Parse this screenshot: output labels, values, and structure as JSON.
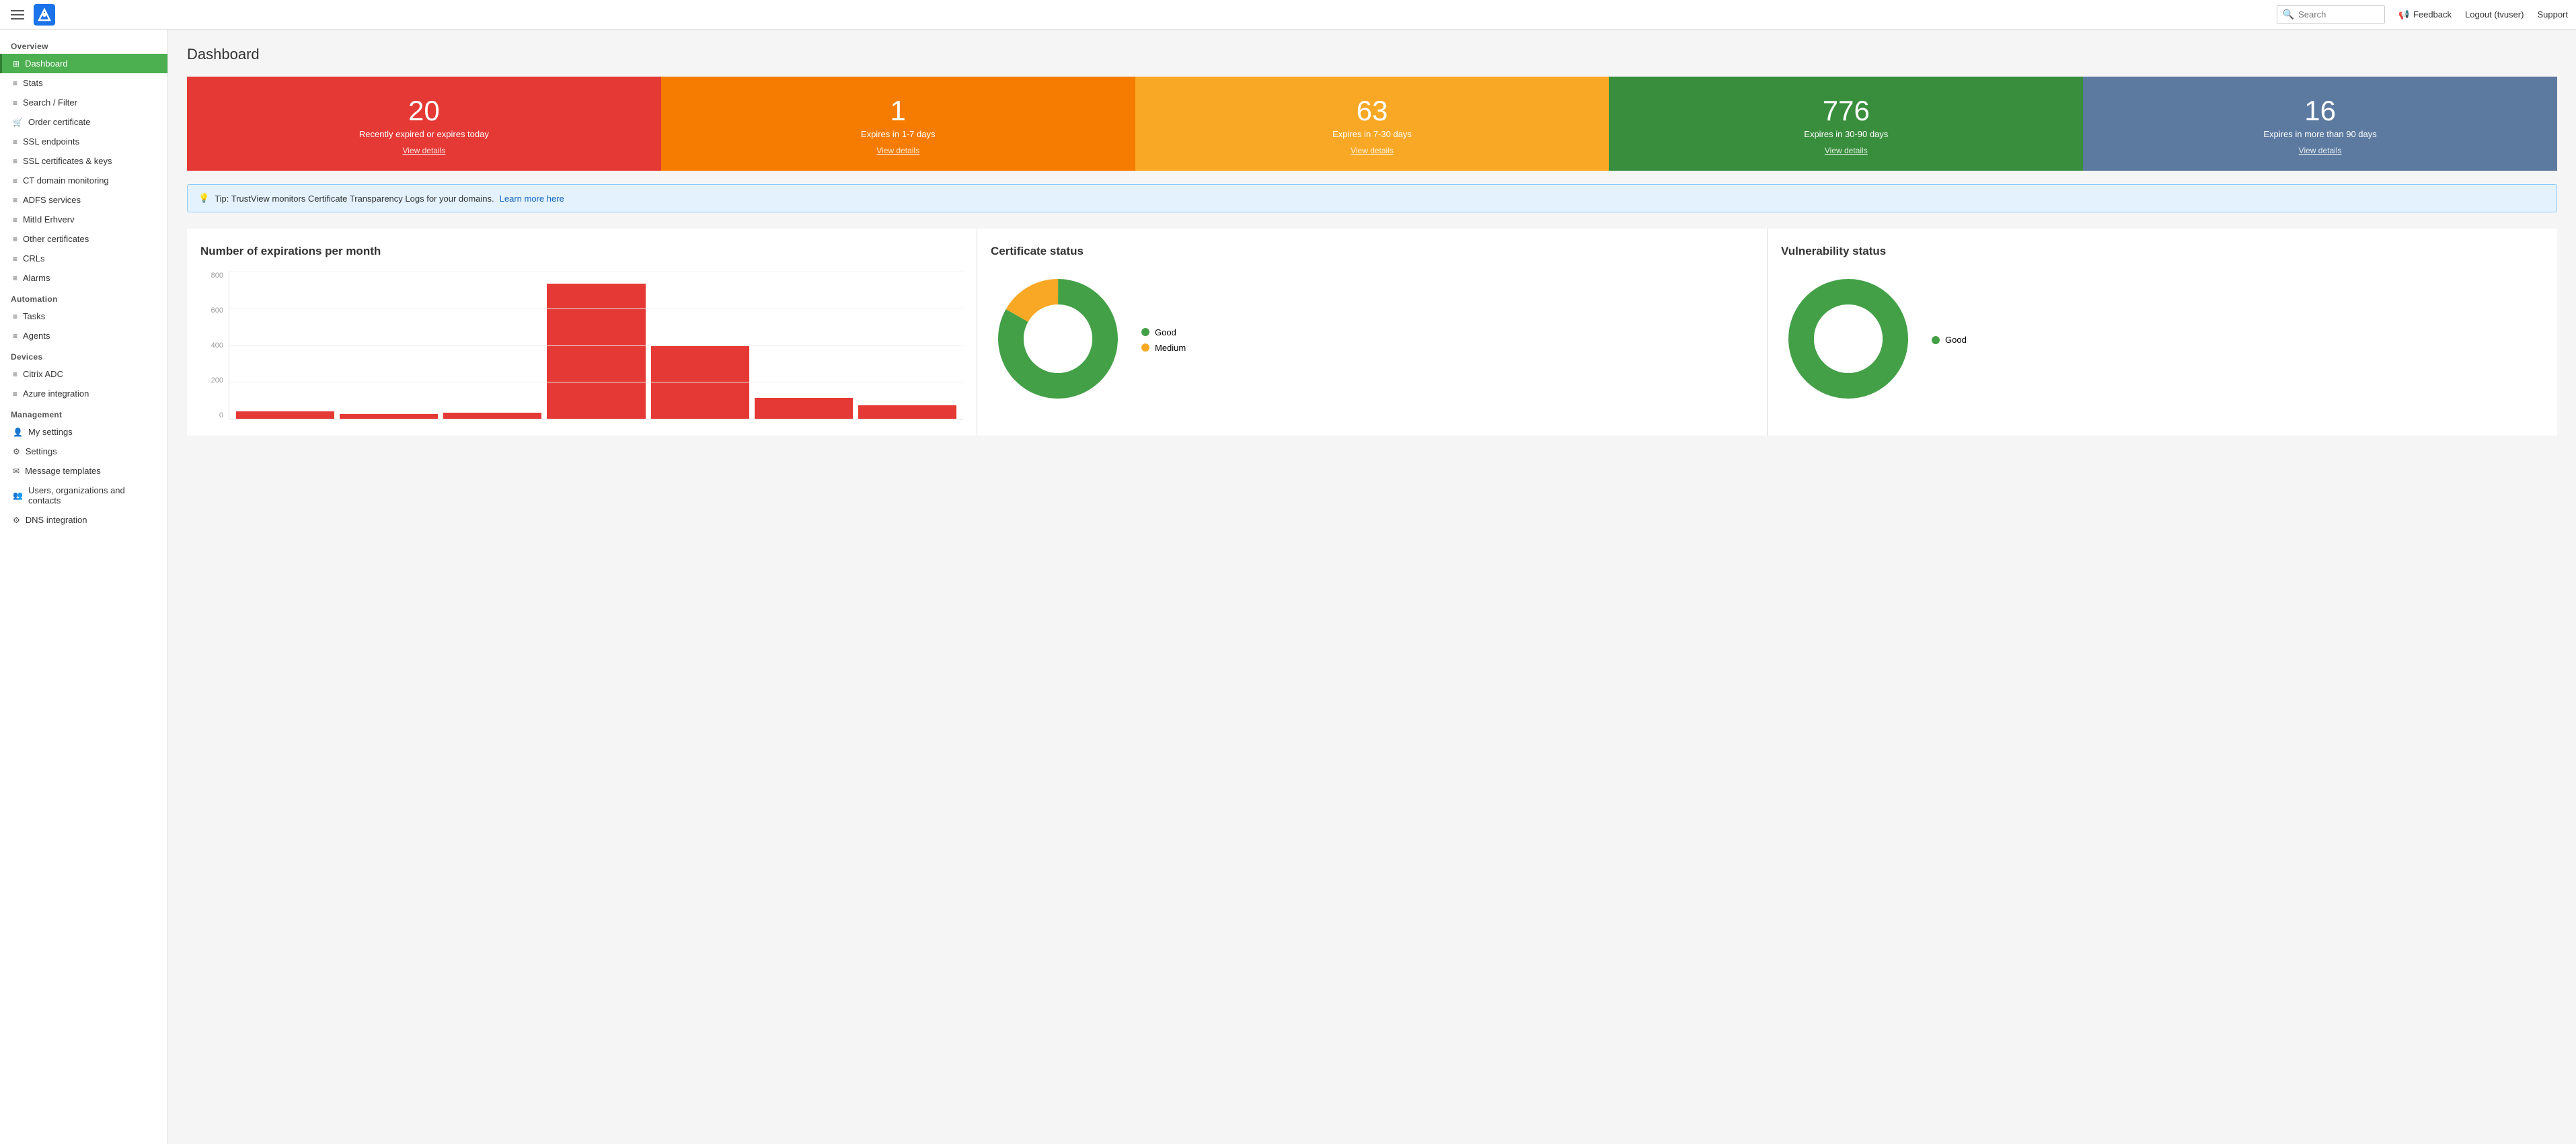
{
  "topbar": {
    "search_placeholder": "Search",
    "feedback_label": "Feedback",
    "logout_label": "Logout (tvuser)",
    "support_label": "Support"
  },
  "sidebar": {
    "overview_label": "Overview",
    "automation_label": "Automation",
    "devices_label": "Devices",
    "management_label": "Management",
    "items": [
      {
        "id": "dashboard",
        "label": "Dashboard",
        "active": true
      },
      {
        "id": "stats",
        "label": "Stats",
        "active": false
      },
      {
        "id": "search-filter",
        "label": "Search / Filter",
        "active": false
      },
      {
        "id": "order-certificate",
        "label": "Order certificate",
        "active": false
      },
      {
        "id": "ssl-endpoints",
        "label": "SSL endpoints",
        "active": false
      },
      {
        "id": "ssl-certificates-keys",
        "label": "SSL certificates & keys",
        "active": false
      },
      {
        "id": "ct-domain-monitoring",
        "label": "CT domain monitoring",
        "active": false
      },
      {
        "id": "adfs-services",
        "label": "ADFS services",
        "active": false
      },
      {
        "id": "mitid-erhverv",
        "label": "MitId Erhverv",
        "active": false
      },
      {
        "id": "other-certificates",
        "label": "Other certificates",
        "active": false
      },
      {
        "id": "crls",
        "label": "CRLs",
        "active": false
      },
      {
        "id": "alarms",
        "label": "Alarms",
        "active": false
      },
      {
        "id": "tasks",
        "label": "Tasks",
        "active": false
      },
      {
        "id": "agents",
        "label": "Agents",
        "active": false
      },
      {
        "id": "citrix-adc",
        "label": "Citrix ADC",
        "active": false
      },
      {
        "id": "azure-integration",
        "label": "Azure integration",
        "active": false
      },
      {
        "id": "my-settings",
        "label": "My settings",
        "active": false
      },
      {
        "id": "settings",
        "label": "Settings",
        "active": false
      },
      {
        "id": "message-templates",
        "label": "Message templates",
        "active": false
      },
      {
        "id": "users-org-contacts",
        "label": "Users, organizations and contacts",
        "active": false
      },
      {
        "id": "dns-integration",
        "label": "DNS integration",
        "active": false
      }
    ]
  },
  "page": {
    "title": "Dashboard"
  },
  "summary_cards": [
    {
      "number": "20",
      "label": "Recently expired or expires today",
      "link": "View details",
      "color_class": "card-red"
    },
    {
      "number": "1",
      "label": "Expires in 1-7 days",
      "link": "View details",
      "color_class": "card-orange"
    },
    {
      "number": "63",
      "label": "Expires in 7-30 days",
      "link": "View details",
      "color_class": "card-yellow"
    },
    {
      "number": "776",
      "label": "Expires in 30-90 days",
      "link": "View details",
      "color_class": "card-green"
    },
    {
      "number": "16",
      "label": "Expires in more than 90 days",
      "link": "View details",
      "color_class": "card-blue"
    }
  ],
  "tip": {
    "text": "Tip: TrustView monitors Certificate Transparency Logs for your domains.",
    "link_text": "Learn more here"
  },
  "charts": {
    "expirations_title": "Number of expirations per month",
    "cert_status_title": "Certificate status",
    "vuln_status_title": "Vulnerability status",
    "bar_y_labels": [
      "800",
      "600",
      "400",
      "200",
      "0"
    ],
    "bars": [
      {
        "height_pct": 5
      },
      {
        "height_pct": 3
      },
      {
        "height_pct": 4
      },
      {
        "height_pct": 85
      },
      {
        "height_pct": 45
      },
      {
        "height_pct": 12
      },
      {
        "height_pct": 8
      }
    ],
    "cert_status_legend": [
      {
        "label": "Good",
        "color": "#43a047"
      },
      {
        "label": "Medium",
        "color": "#f9a825"
      }
    ],
    "cert_good_pct": "83.2%",
    "cert_medium_pct": "16.9%",
    "vuln_legend": [
      {
        "label": "Good",
        "color": "#43a047"
      }
    ]
  }
}
